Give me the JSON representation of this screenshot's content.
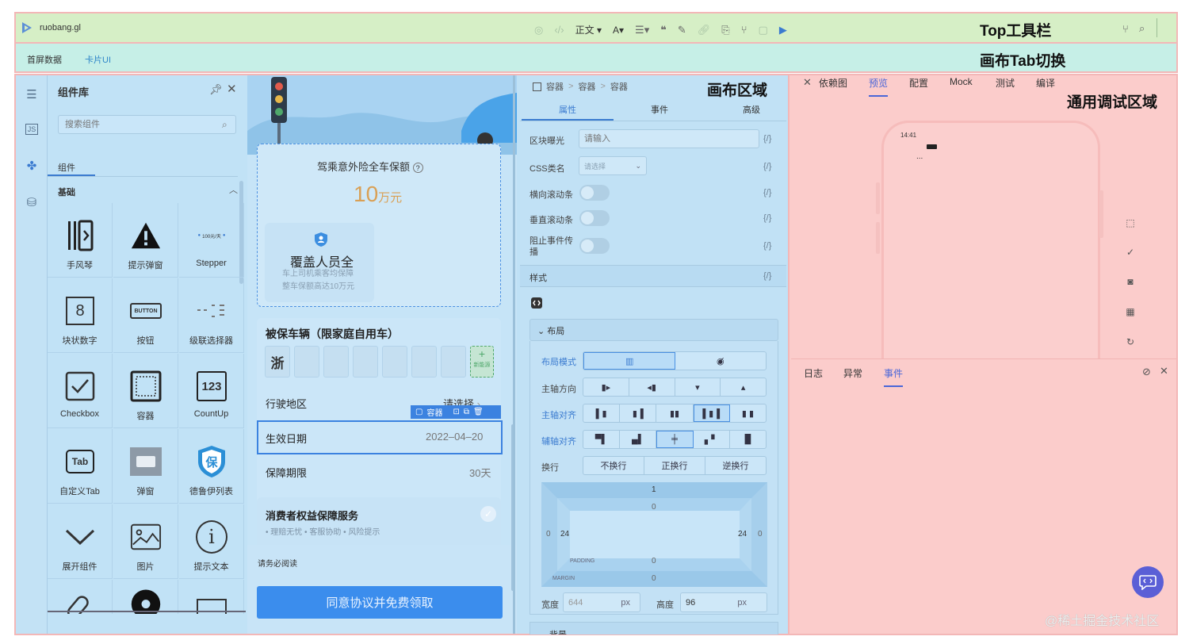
{
  "annotations": {
    "top_toolbar": "Top工具栏",
    "canvas_tab_switch": "画布Tab切换",
    "canvas_area": "画布区域",
    "debug_area": "通用调试区域"
  },
  "toolbar": {
    "app_name": "ruobang.gl",
    "text_style": "正文",
    "font_menu": "A"
  },
  "canvas_tabs": [
    {
      "label": "首屏数据",
      "active": false
    },
    {
      "label": "卡片UI",
      "active": true
    }
  ],
  "library": {
    "title": "组件库",
    "search_placeholder": "搜索组件",
    "tab": "组件",
    "group": "基础",
    "items": [
      {
        "label": "手风琴",
        "icon": "accordion-icon"
      },
      {
        "label": "提示弹窗",
        "icon": "warning-icon"
      },
      {
        "label": "Stepper",
        "icon": "stepper-icon",
        "icon_text": "100元/天"
      },
      {
        "label": "块状数字",
        "icon": "block-number-icon",
        "icon_text": "8"
      },
      {
        "label": "按钮",
        "icon": "button-icon",
        "icon_text": "BUTTON"
      },
      {
        "label": "级联选择器",
        "icon": "cascader-icon"
      },
      {
        "label": "Checkbox",
        "icon": "checkbox-icon"
      },
      {
        "label": "容器",
        "icon": "container-icon"
      },
      {
        "label": "CountUp",
        "icon": "countup-icon",
        "icon_text": "123"
      },
      {
        "label": "自定义Tab",
        "icon": "tab-icon",
        "icon_text": "Tab"
      },
      {
        "label": "弹窗",
        "icon": "dialog-icon"
      },
      {
        "label": "德鲁伊列表",
        "icon": "shield-icon",
        "icon_text": "保"
      },
      {
        "label": "展开组件",
        "icon": "chevron-down-icon"
      },
      {
        "label": "图片",
        "icon": "image-icon"
      },
      {
        "label": "提示文本",
        "icon": "info-icon",
        "icon_text": "i"
      }
    ]
  },
  "canvas": {
    "insurance_title": "驾乘意外险全车保额",
    "amount": "10",
    "amount_unit": "万元",
    "coverage_title": "覆盖人员全",
    "coverage_line1": "车上司机乘客均保障",
    "coverage_line2": "整车保额高达10万元",
    "vehicle_title": "被保车辆（限家庭自用车）",
    "plate_prefix": "浙",
    "new_energy": "新能源",
    "region_label": "行驶地区",
    "region_value": "请选择",
    "selected_tag": "容器",
    "date_label": "生效日期",
    "date_value": "2022–04–20",
    "period_label": "保障期限",
    "period_value": "30天",
    "service_title": "消费者权益保障服务",
    "service_items": "• 理赔无忧  • 客服协助  • 风险提示",
    "must_read": "请务必阅读",
    "cta": "同意协议并免费领取"
  },
  "props": {
    "breadcrumb": [
      "容器",
      "容器",
      "容器"
    ],
    "tabs": [
      "属性",
      "事件",
      "高级"
    ],
    "exposure_label": "区块曝光",
    "exposure_placeholder": "请输入",
    "css_label": "CSS类名",
    "css_placeholder": "请选择",
    "hscroll_label": "横向滚动条",
    "vscroll_label": "垂直滚动条",
    "stop_label": "阻止事件传播",
    "brace": "{/}",
    "style_section": "样式",
    "layout_section": "布局",
    "layout_mode": "布局模式",
    "main_dir": "主轴方向",
    "main_align": "主轴对齐",
    "cross_align": "辅轴对齐",
    "wrap": "换行",
    "wrap_options": [
      "不换行",
      "正换行",
      "逆换行"
    ],
    "box": {
      "margin_top": "1",
      "padding_top": "0",
      "left_outer": "0",
      "left_inner": "24",
      "right_inner": "24",
      "right_outer": "0",
      "padding_bottom": "0",
      "margin_bottom": "0",
      "padding_label": "PADDING",
      "margin_label": "MARGIN"
    },
    "width_label": "宽度",
    "width_value": "644",
    "height_label": "高度",
    "height_value": "96",
    "unit": "px",
    "next_section": "背景"
  },
  "debug": {
    "tabs": [
      "依赖图",
      "预览",
      "配置",
      "Mock",
      "测试",
      "编译"
    ],
    "active_tab": "预览",
    "phone_time": "14:41",
    "phone_dots": "...",
    "log_tabs": [
      "日志",
      "异常",
      "事件"
    ],
    "active_log_tab": "事件"
  },
  "watermark": "@稀土掘金技术社区"
}
